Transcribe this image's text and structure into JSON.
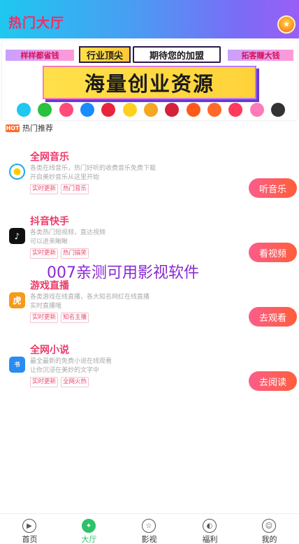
{
  "header": {
    "title": "热门大厅",
    "badge_icon": "vip-badge-icon"
  },
  "banner": {
    "left_text": "样样都省钱",
    "chip1": "行业顶尖",
    "chip2": "期待您的加盟",
    "right_text": "拓客赚大钱",
    "main_text": "海量创业资源",
    "app_icons": [
      "tencent-video-icon",
      "iqiyi-icon",
      "youku-icon",
      "kugou-icon",
      "netease-music-icon",
      "yellow-mascot-icon",
      "qq-icon",
      "qq-red-icon",
      "ximalaya-icon",
      "momo-icon",
      "weishi-icon",
      "weibo-icon",
      "headphones-icon"
    ],
    "app_colors": [
      "#1ec8f0",
      "#28c23e",
      "#ff4a7a",
      "#1a8cff",
      "#e8253a",
      "#ffd020",
      "#f5a623",
      "#d4223a",
      "#ff5a1a",
      "#ff6a2a",
      "#ff3a5a",
      "#ff7ab8",
      "#333333"
    ]
  },
  "section": {
    "hot_badge": "HOT",
    "title": "热门推荐"
  },
  "cards": [
    {
      "title": "全网音乐",
      "desc1": "各类在线音乐，热门好听的收费音乐免费下载",
      "desc2": "开启美妙音乐从这里开始",
      "tag1": "实时更新",
      "tag2": "热门音乐",
      "button": "听音乐",
      "icon": "music-disc-icon",
      "icon_color": "#1aa8f0"
    },
    {
      "title": "抖音快手",
      "desc1": "各类热门短视频，直达视频",
      "desc2": "可以进来瞅瞅",
      "tag1": "实时更新",
      "tag2": "热门搞笑",
      "button": "看视频",
      "icon": "tiktok-icon",
      "icon_color": "#111111"
    },
    {
      "title": "游戏直播",
      "desc1": "各类游戏在线直播，各大知名网红在线直播",
      "desc2": "实时直播哦",
      "tag1": "实时更新",
      "tag2": "知名主播",
      "button": "去观看",
      "icon": "tiger-mascot-icon",
      "icon_color": "#f59a1a"
    },
    {
      "title": "全网小说",
      "desc1": "最全最新的免费小说在线观看",
      "desc2": "让你沉浸在美妙的文字中",
      "tag1": "实时更新",
      "tag2": "全网火热",
      "button": "去阅读",
      "icon": "novel-book-icon",
      "icon_color": "#2a8cf0"
    }
  ],
  "watermark": "007亲测可用影视软件",
  "tabs": [
    {
      "label": "首页",
      "icon": "play-circle-icon",
      "glyph": "▶"
    },
    {
      "label": "大厅",
      "icon": "leaf-icon",
      "glyph": "✦"
    },
    {
      "label": "影视",
      "icon": "star-badge-icon",
      "glyph": "☆"
    },
    {
      "label": "福利",
      "icon": "pacman-icon",
      "glyph": "◐"
    },
    {
      "label": "我的",
      "icon": "smile-icon",
      "glyph": "☺"
    }
  ],
  "active_tab": 1
}
